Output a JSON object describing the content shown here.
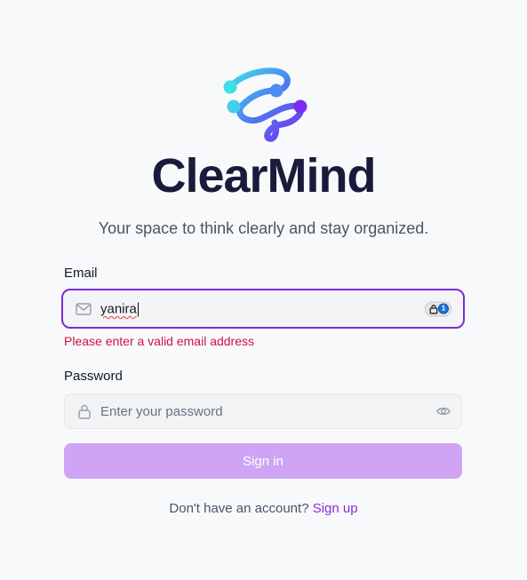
{
  "brand": {
    "name": "ClearMind",
    "tagline": "Your space to think clearly and stay organized.",
    "gradient": [
      "#3ee0e8",
      "#4b7cf2",
      "#7a2cf0"
    ],
    "wordmark_color": "#1a1a3a"
  },
  "form": {
    "email": {
      "label": "Email",
      "value": "yanira",
      "error": "Please enter a valid email address",
      "icon": "mail-icon"
    },
    "password": {
      "label": "Password",
      "placeholder": "Enter your password",
      "icon": "lock-icon",
      "toggle_icon": "eye-icon"
    },
    "submit_label": "Sign in"
  },
  "footer": {
    "prompt": "Don't have an account?",
    "link_label": "Sign up"
  },
  "colors": {
    "accent": "#7c2bd6",
    "error": "#d1123f",
    "button_disabled": "#cfa4f4",
    "link": "#8a2fd1"
  }
}
